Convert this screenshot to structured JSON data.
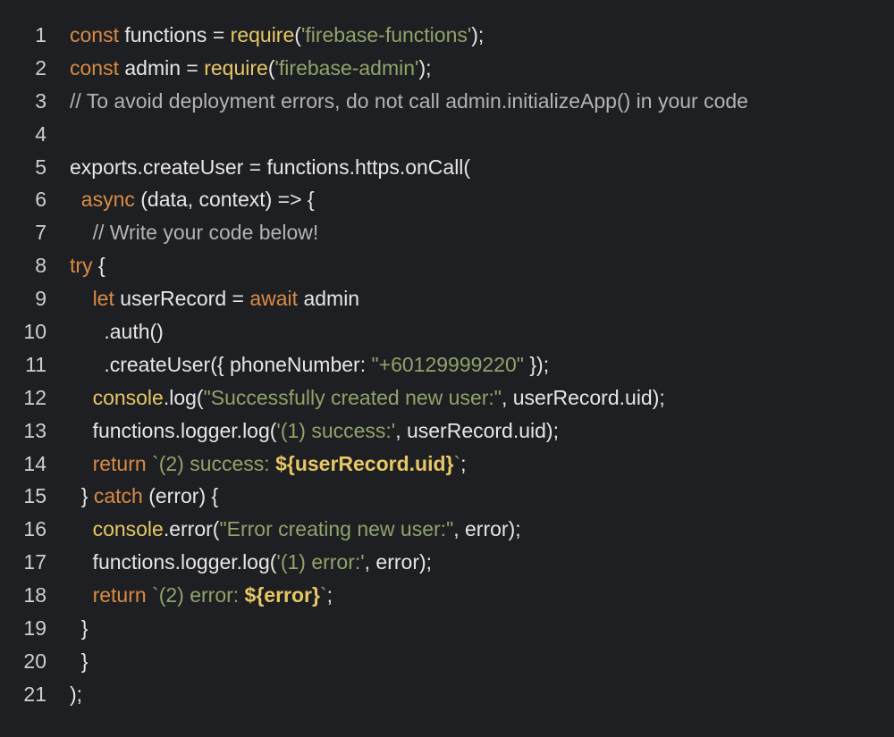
{
  "editor": {
    "theme_colors": {
      "background": "#1e1f22",
      "keyword": "#d98b45",
      "function": "#e7c865",
      "string": "#8fa46a",
      "comment": "#b3b3b3",
      "plain": "#e6e6e6"
    },
    "lines": [
      {
        "num": "1",
        "tokens": [
          {
            "t": "kw",
            "v": "const"
          },
          {
            "t": "pl",
            "v": " functions = "
          },
          {
            "t": "fn",
            "v": "require"
          },
          {
            "t": "pl",
            "v": "("
          },
          {
            "t": "str",
            "v": "'firebase-functions'"
          },
          {
            "t": "pl",
            "v": ");"
          }
        ]
      },
      {
        "num": "2",
        "tokens": [
          {
            "t": "kw",
            "v": "const"
          },
          {
            "t": "pl",
            "v": " admin = "
          },
          {
            "t": "fn",
            "v": "require"
          },
          {
            "t": "pl",
            "v": "("
          },
          {
            "t": "str",
            "v": "'firebase-admin'"
          },
          {
            "t": "pl",
            "v": ");"
          }
        ]
      },
      {
        "num": "3",
        "tokens": [
          {
            "t": "cmt",
            "v": "// To avoid deployment errors, do not call admin.initializeApp() in your code"
          }
        ]
      },
      {
        "num": "4",
        "tokens": []
      },
      {
        "num": "5",
        "tokens": [
          {
            "t": "pl",
            "v": "exports.createUser = functions.https.onCall("
          }
        ]
      },
      {
        "num": "6",
        "tokens": [
          {
            "t": "pl",
            "v": "  "
          },
          {
            "t": "kw",
            "v": "async"
          },
          {
            "t": "pl",
            "v": " (data, context) => {"
          }
        ]
      },
      {
        "num": "7",
        "tokens": [
          {
            "t": "pl",
            "v": "    "
          },
          {
            "t": "cmt",
            "v": "// Write your code below!"
          }
        ]
      },
      {
        "num": "8",
        "tokens": [
          {
            "t": "kw",
            "v": "try"
          },
          {
            "t": "pl",
            "v": " {"
          }
        ]
      },
      {
        "num": "9",
        "tokens": [
          {
            "t": "pl",
            "v": "    "
          },
          {
            "t": "kw",
            "v": "let"
          },
          {
            "t": "pl",
            "v": " userRecord = "
          },
          {
            "t": "kw",
            "v": "await"
          },
          {
            "t": "pl",
            "v": " admin"
          }
        ]
      },
      {
        "num": "10",
        "tokens": [
          {
            "t": "pl",
            "v": "      .auth()"
          }
        ]
      },
      {
        "num": "11",
        "tokens": [
          {
            "t": "pl",
            "v": "      .createUser({ phoneNumber: "
          },
          {
            "t": "str",
            "v": "\"+60129999220\""
          },
          {
            "t": "pl",
            "v": " });"
          }
        ]
      },
      {
        "num": "12",
        "tokens": [
          {
            "t": "pl",
            "v": "    "
          },
          {
            "t": "fn",
            "v": "console"
          },
          {
            "t": "pl",
            "v": ".log("
          },
          {
            "t": "str",
            "v": "\"Successfully created new user:\""
          },
          {
            "t": "pl",
            "v": ", userRecord.uid);"
          }
        ]
      },
      {
        "num": "13",
        "tokens": [
          {
            "t": "pl",
            "v": "    functions.logger.log("
          },
          {
            "t": "str",
            "v": "'(1) success:'"
          },
          {
            "t": "pl",
            "v": ", userRecord.uid);"
          }
        ]
      },
      {
        "num": "14",
        "tokens": [
          {
            "t": "pl",
            "v": "    "
          },
          {
            "t": "kw",
            "v": "return"
          },
          {
            "t": "pl",
            "v": " "
          },
          {
            "t": "str",
            "v": "`(2) success: "
          },
          {
            "t": "tb",
            "v": "${userRecord.uid}"
          },
          {
            "t": "str",
            "v": "`"
          },
          {
            "t": "pl",
            "v": ";"
          }
        ]
      },
      {
        "num": "15",
        "tokens": [
          {
            "t": "pl",
            "v": "  } "
          },
          {
            "t": "kw",
            "v": "catch"
          },
          {
            "t": "pl",
            "v": " (error) {"
          }
        ]
      },
      {
        "num": "16",
        "tokens": [
          {
            "t": "pl",
            "v": "    "
          },
          {
            "t": "fn",
            "v": "console"
          },
          {
            "t": "pl",
            "v": ".error("
          },
          {
            "t": "str",
            "v": "\"Error creating new user:\""
          },
          {
            "t": "pl",
            "v": ", error);"
          }
        ]
      },
      {
        "num": "17",
        "tokens": [
          {
            "t": "pl",
            "v": "    functions.logger.log("
          },
          {
            "t": "str",
            "v": "'(1) error:'"
          },
          {
            "t": "pl",
            "v": ", error);"
          }
        ]
      },
      {
        "num": "18",
        "tokens": [
          {
            "t": "pl",
            "v": "    "
          },
          {
            "t": "kw",
            "v": "return"
          },
          {
            "t": "pl",
            "v": " "
          },
          {
            "t": "str",
            "v": "`(2) error: "
          },
          {
            "t": "tb",
            "v": "${error}"
          },
          {
            "t": "str",
            "v": "`"
          },
          {
            "t": "pl",
            "v": ";"
          }
        ]
      },
      {
        "num": "19",
        "tokens": [
          {
            "t": "pl",
            "v": "  }"
          }
        ]
      },
      {
        "num": "20",
        "tokens": [
          {
            "t": "pl",
            "v": "  }"
          }
        ]
      },
      {
        "num": "21",
        "tokens": [
          {
            "t": "pl",
            "v": ");"
          }
        ]
      }
    ]
  }
}
